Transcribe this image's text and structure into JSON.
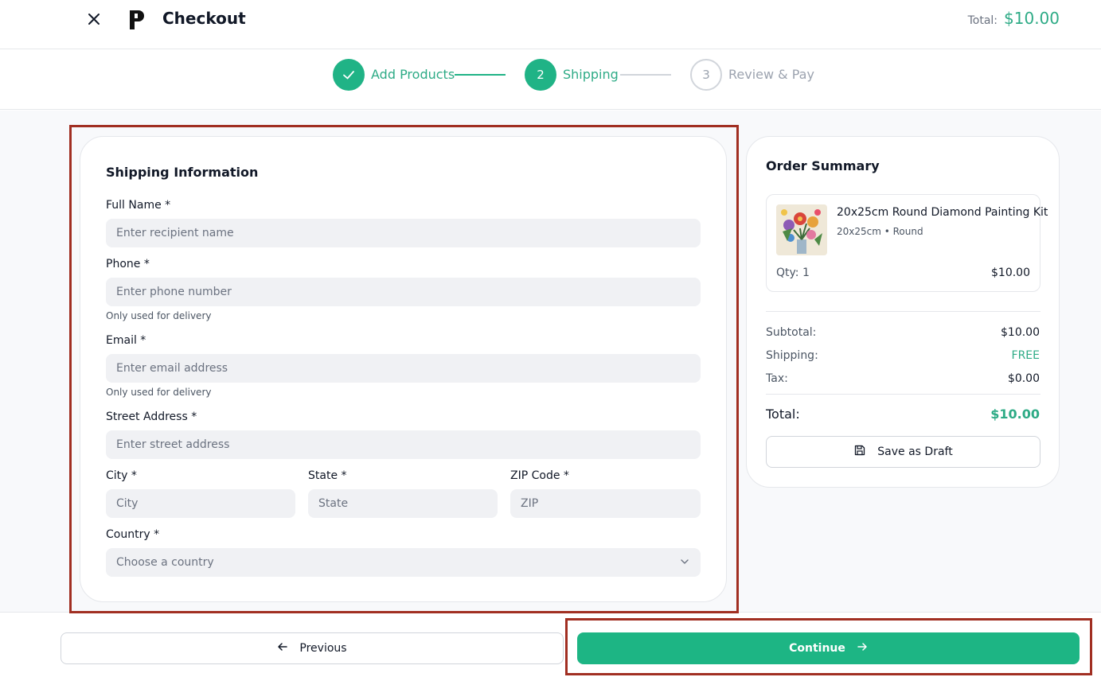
{
  "header": {
    "title": "Checkout",
    "total_label": "Total:",
    "total_value": "$10.00"
  },
  "stepper": {
    "steps": [
      {
        "label": "Add Products",
        "number": "",
        "state": "done"
      },
      {
        "label": "Shipping",
        "number": "2",
        "state": "active"
      },
      {
        "label": "Review & Pay",
        "number": "3",
        "state": "todo"
      }
    ]
  },
  "form": {
    "title": "Shipping Information",
    "full_name": {
      "label": "Full Name *",
      "placeholder": "Enter recipient name",
      "value": ""
    },
    "phone": {
      "label": "Phone *",
      "placeholder": "Enter phone number",
      "value": "",
      "hint": "Only used for delivery"
    },
    "email": {
      "label": "Email *",
      "placeholder": "Enter email address",
      "value": "",
      "hint": "Only used for delivery"
    },
    "street": {
      "label": "Street Address *",
      "placeholder": "Enter street address",
      "value": ""
    },
    "city": {
      "label": "City *",
      "placeholder": "City",
      "value": ""
    },
    "state": {
      "label": "State *",
      "placeholder": "State",
      "value": ""
    },
    "zip": {
      "label": "ZIP Code *",
      "placeholder": "ZIP",
      "value": ""
    },
    "country": {
      "label": "Country *",
      "selected": "Choose a country"
    }
  },
  "summary": {
    "title": "Order Summary",
    "item": {
      "name": "20x25cm Round Diamond Painting Kit",
      "meta": "20x25cm • Round",
      "qty": "Qty: 1",
      "price": "$10.00"
    },
    "rows": [
      {
        "label": "Subtotal:",
        "value": "$10.00"
      },
      {
        "label": "Shipping:",
        "value": "FREE"
      },
      {
        "label": "Tax:",
        "value": "$0.00"
      }
    ],
    "total_label": "Total:",
    "total_value": "$10.00",
    "draft_label": "Save as Draft"
  },
  "footer": {
    "previous_label": "Previous",
    "continue_label": "Continue"
  },
  "colors": {
    "accent": "#20b386",
    "accent_text": "#2eab86",
    "highlight_border": "#a12f22"
  }
}
